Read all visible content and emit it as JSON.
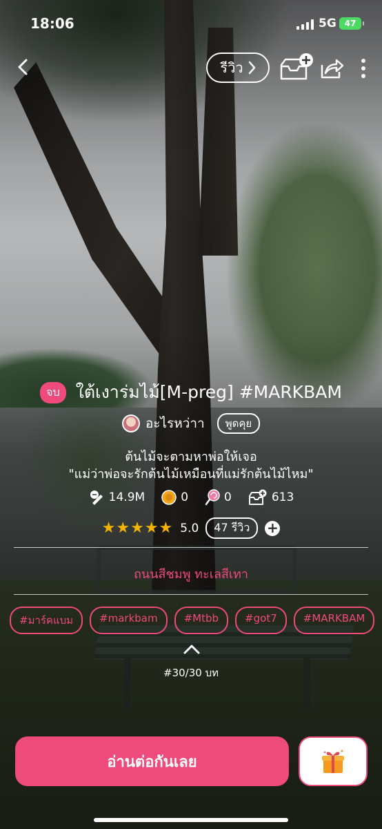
{
  "status_bar": {
    "time": "18:06",
    "network": "5G",
    "battery": "47"
  },
  "nav": {
    "review_label": "รีวิว"
  },
  "story": {
    "status_badge": "จบ",
    "title": "ใต้เงาร่มไม้[M-preg] #MARKBAM",
    "author": "อะไรหว่าา",
    "talk_label": "พูดคุย",
    "tagline_1": "ต้นไม้จะตามหาพ่อให้เจอ",
    "tagline_2": "\"แม่ว่าพ่อจะรักต้นไม้เหมือนที่แม่รักต้นไม้ไหม\"",
    "stats": {
      "views": "14.9M",
      "coins": "0",
      "candies": "0",
      "shelf_adds": "613"
    },
    "rating": "5.0",
    "reviews_label": "47 รีวิว",
    "category": "ถนนสีชมพู ทะเลสีเทา",
    "tags": [
      "#มาร์คแบม",
      "#markbam",
      "#Mtbb",
      "#got7",
      "#MARKBAM"
    ],
    "episodes": "#30/30 บท"
  },
  "actions": {
    "read_label": "อ่านต่อกันเลย"
  },
  "colors": {
    "accent": "#ee4a7b",
    "star": "#f5b301",
    "battery": "#4cd964"
  },
  "icons": [
    "back-icon",
    "chevron-right-icon",
    "add-to-shelf-icon",
    "share-icon",
    "more-icon",
    "views-icon",
    "coin-icon",
    "candy-icon",
    "shelf-icon",
    "star-icon",
    "plus-icon",
    "chevron-up-icon",
    "gift-icon"
  ]
}
